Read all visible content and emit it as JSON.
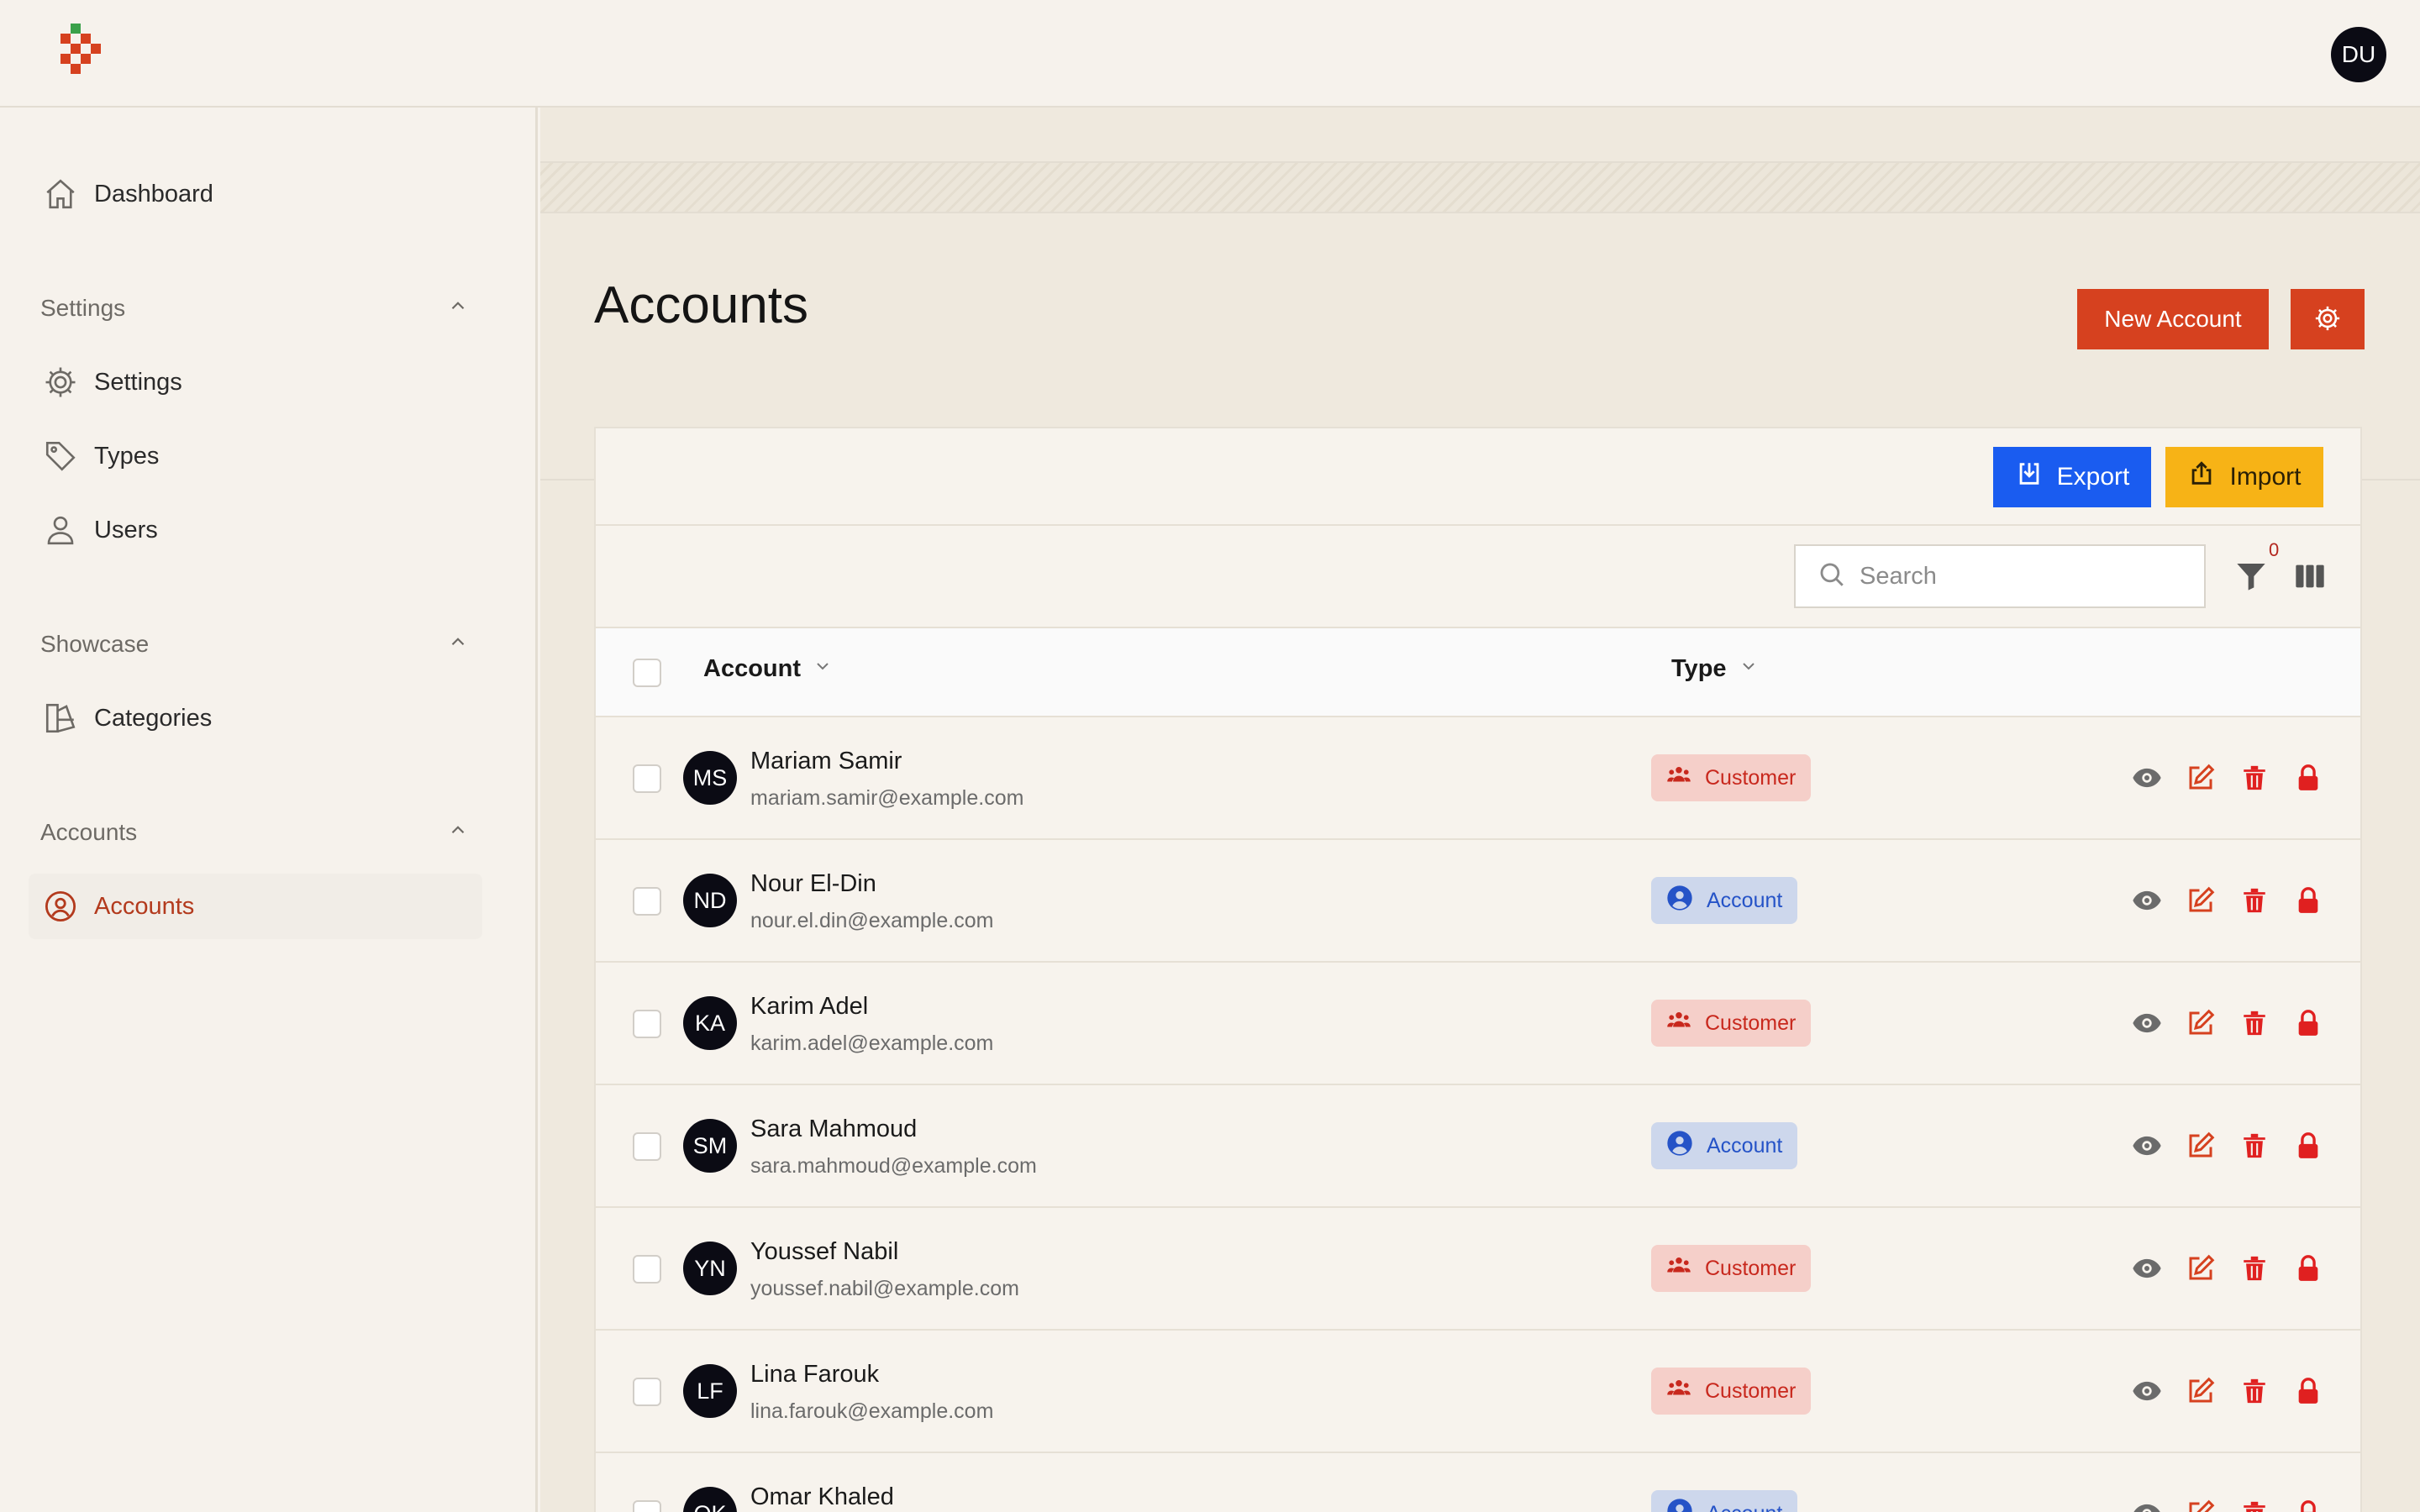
{
  "header": {
    "user_initials": "DU"
  },
  "sidebar": {
    "dashboard_label": "Dashboard",
    "sections": [
      {
        "title": "Settings",
        "items": [
          {
            "label": "Settings"
          },
          {
            "label": "Types"
          },
          {
            "label": "Users"
          }
        ]
      },
      {
        "title": "Showcase",
        "items": [
          {
            "label": "Categories"
          }
        ]
      },
      {
        "title": "Accounts",
        "items": [
          {
            "label": "Accounts",
            "active": true
          }
        ]
      }
    ]
  },
  "page": {
    "title": "Accounts",
    "new_button": "New Account"
  },
  "toolbar": {
    "export_label": "Export",
    "import_label": "Import",
    "search_placeholder": "Search",
    "filter_count": "0"
  },
  "table": {
    "columns": {
      "account": "Account",
      "type": "Type"
    },
    "rows": [
      {
        "initials": "MS",
        "name": "Mariam Samir",
        "email": "mariam.samir@example.com",
        "type": "Customer"
      },
      {
        "initials": "ND",
        "name": "Nour El-Din",
        "email": "nour.el.din@example.com",
        "type": "Account"
      },
      {
        "initials": "KA",
        "name": "Karim Adel",
        "email": "karim.adel@example.com",
        "type": "Customer"
      },
      {
        "initials": "SM",
        "name": "Sara Mahmoud",
        "email": "sara.mahmoud@example.com",
        "type": "Account"
      },
      {
        "initials": "YN",
        "name": "Youssef Nabil",
        "email": "youssef.nabil@example.com",
        "type": "Customer"
      },
      {
        "initials": "LF",
        "name": "Lina Farouk",
        "email": "lina.farouk@example.com",
        "type": "Customer"
      },
      {
        "initials": "OK",
        "name": "Omar Khaled",
        "email": "",
        "type": "Account"
      }
    ]
  },
  "colors": {
    "brand": "#d6411f",
    "export": "#1a5cf0",
    "import": "#f7b316",
    "customer_badge_text": "#c8281d",
    "account_badge_text": "#2553c7"
  },
  "icons": {
    "row_actions": [
      "eye-icon",
      "edit-icon",
      "trash-icon",
      "lock-icon"
    ]
  }
}
